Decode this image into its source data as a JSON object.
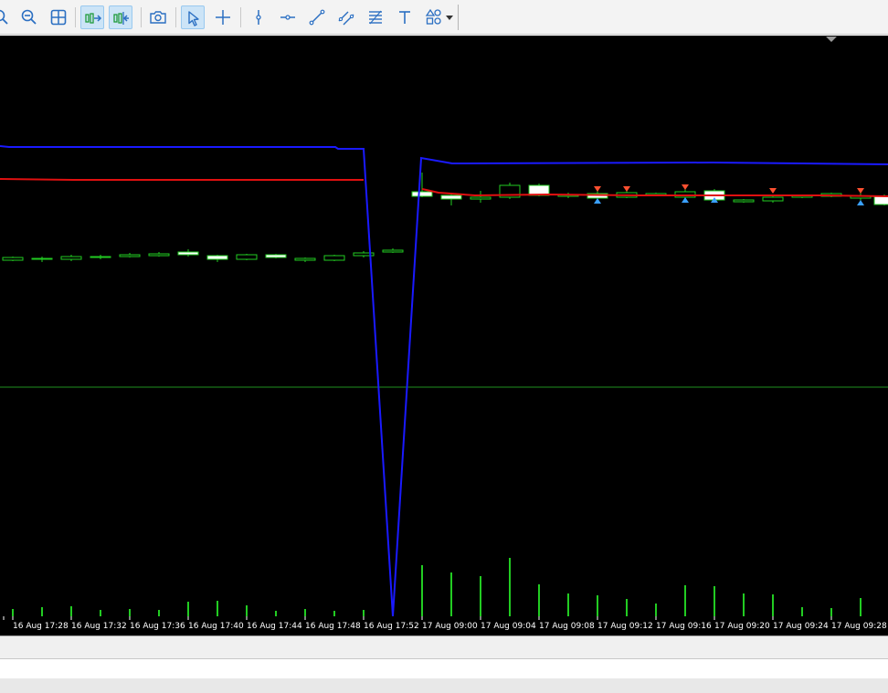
{
  "toolbar": {
    "buttons": [
      {
        "name": "zoom-in-button",
        "icon": "zoom-in-icon",
        "active": false
      },
      {
        "name": "zoom-out-button",
        "icon": "zoom-out-icon",
        "active": false
      },
      {
        "name": "grid-button",
        "icon": "grid-icon",
        "active": false
      },
      {
        "name": "auto-scroll-button",
        "icon": "auto-scroll-icon",
        "active": true
      },
      {
        "name": "chart-shift-button",
        "icon": "chart-shift-icon",
        "active": true
      },
      {
        "name": "screenshot-button",
        "icon": "camera-icon",
        "active": false
      },
      {
        "name": "cursor-button",
        "icon": "cursor-icon",
        "active": true
      },
      {
        "name": "crosshair-button",
        "icon": "crosshair-icon",
        "active": false
      },
      {
        "name": "vertical-line-button",
        "icon": "vertical-line-icon",
        "active": false
      },
      {
        "name": "horizontal-line-button",
        "icon": "horizontal-line-icon",
        "active": false
      },
      {
        "name": "trend-line-button",
        "icon": "trend-line-icon",
        "active": false
      },
      {
        "name": "equidistant-channel-button",
        "icon": "channel-icon",
        "active": false
      },
      {
        "name": "fibonacci-button",
        "icon": "fibonacci-icon",
        "active": false
      },
      {
        "name": "text-button",
        "icon": "text-icon",
        "active": false
      },
      {
        "name": "shapes-button",
        "icon": "shapes-icon",
        "active": false
      }
    ]
  },
  "chart": {
    "background": "#000000",
    "time_labels": [
      "4",
      "16 Aug 17:28",
      "16 Aug 17:32",
      "16 Aug 17:36",
      "16 Aug 17:40",
      "16 Aug 17:44",
      "16 Aug 17:48",
      "16 Aug 17:52",
      "17 Aug 09:00",
      "17 Aug 09:04",
      "17 Aug 09:08",
      "17 Aug 09:12",
      "17 Aug 09:16",
      "17 Aug 09:20",
      "17 Aug 09:24",
      "17 Aug 09:28"
    ],
    "colors": {
      "blue_line": "#1a1aff",
      "red_line": "#e01010",
      "candle": "#22cc22",
      "volume": "#22cc22",
      "level_line": "#1f8f1f",
      "sell_arrow": "#ff5030",
      "buy_arrow": "#3aa0ff"
    }
  }
}
